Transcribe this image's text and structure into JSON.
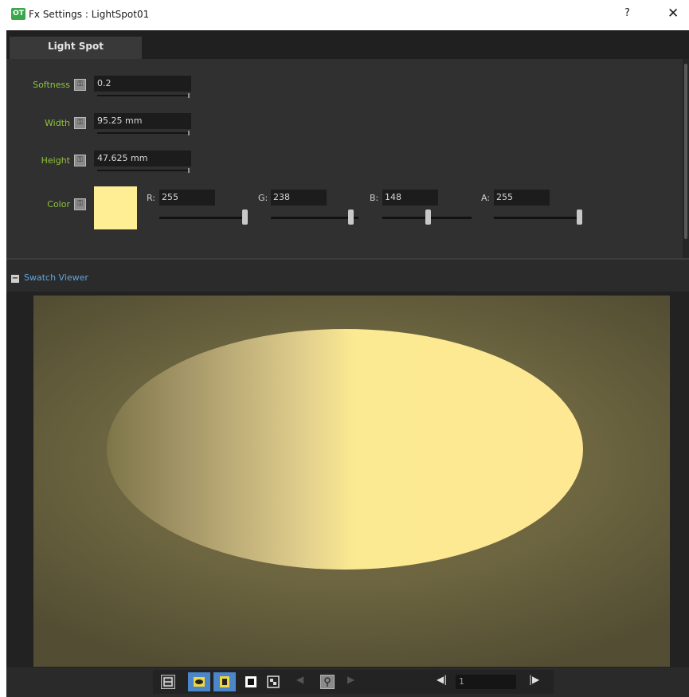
{
  "window": {
    "title": "Fx Settings : LightSpot01",
    "help": "?",
    "close": "✕"
  },
  "tabs": [
    {
      "label": "Light Spot",
      "active": true
    }
  ],
  "params": {
    "softness": {
      "label": "Softness",
      "value": "0.2"
    },
    "width": {
      "label": "Width",
      "value": "95.25 mm"
    },
    "height": {
      "label": "Height",
      "value": "47.625 mm"
    },
    "color": {
      "label": "Color",
      "swatch": "#ffee94",
      "channels": [
        {
          "label": "R:",
          "value": "255",
          "fraction": 1.0
        },
        {
          "label": "G:",
          "value": "238",
          "fraction": 0.933
        },
        {
          "label": "B:",
          "value": "148",
          "fraction": 0.58
        },
        {
          "label": "A:",
          "value": "255",
          "fraction": 1.0
        }
      ]
    }
  },
  "swatch_viewer": {
    "title": "Swatch Viewer",
    "collapse_icon": "minus-icon"
  },
  "toolbar": {
    "frame_value": "1",
    "icons": [
      "compare-icon",
      "preview-eye-icon",
      "white-bg-icon",
      "black-bg-icon",
      "checker-bg-icon",
      "prev-key-icon",
      "key-icon",
      "next-key-icon",
      "prev-frame-icon",
      "next-frame-icon"
    ]
  },
  "colors": {
    "param_label": "#8ec43a",
    "accent": "#f1d640",
    "swatch_title": "#5fa6e0"
  }
}
